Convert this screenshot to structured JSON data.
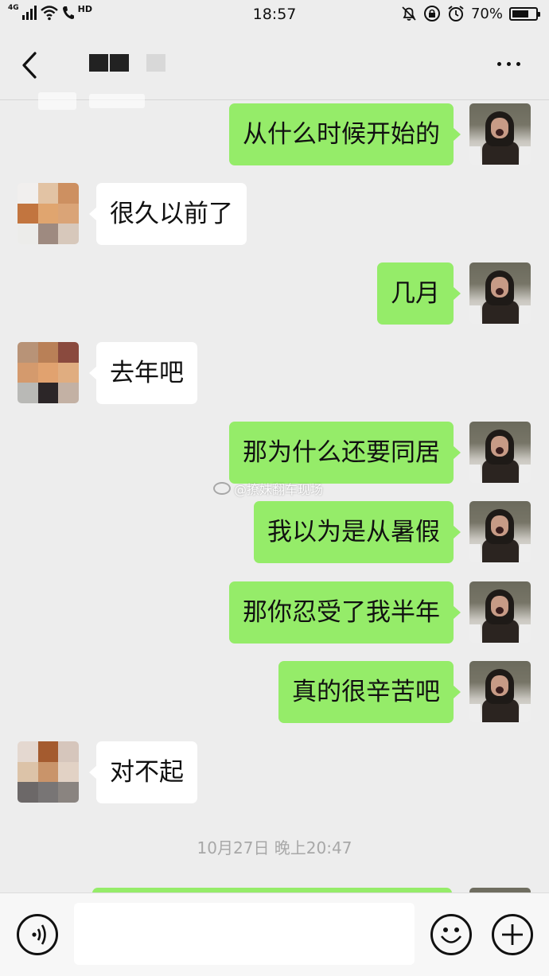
{
  "status_bar": {
    "network": "4G",
    "call_hd": "HD",
    "time": "18:57",
    "battery_percent": "70%",
    "battery_level": 0.7,
    "icons": [
      "signal-icon",
      "wifi-icon",
      "phone-hd-icon",
      "mute-icon",
      "rotation-lock-icon",
      "alarm-icon",
      "battery-icon"
    ]
  },
  "nav": {
    "back_icon": "chevron-left-icon",
    "more_icon": "more-dots-icon"
  },
  "messages": [
    {
      "side": "out",
      "text": "从什么时候开始的"
    },
    {
      "side": "in",
      "text": "很久以前了"
    },
    {
      "side": "out",
      "text": "几月"
    },
    {
      "side": "in",
      "text": "去年吧"
    },
    {
      "side": "out",
      "text": "那为什么还要同居"
    },
    {
      "side": "out",
      "text": "我以为是从暑假"
    },
    {
      "side": "out",
      "text": "那你忍受了我半年"
    },
    {
      "side": "out",
      "text": "真的很辛苦吧"
    },
    {
      "side": "in",
      "text": "对不起"
    }
  ],
  "timestamp": "10月27日 晚上20:47",
  "watermark": "@撩妹翻车现场",
  "bottom_bar": {
    "voice_icon": "voice-icon",
    "emoji_icon": "emoji-icon",
    "plus_icon": "plus-icon",
    "input_value": ""
  },
  "colors": {
    "background": "#ededed",
    "outgoing_bubble": "#95ec69",
    "incoming_bubble": "#ffffff",
    "timestamp": "#a8a8a8"
  }
}
